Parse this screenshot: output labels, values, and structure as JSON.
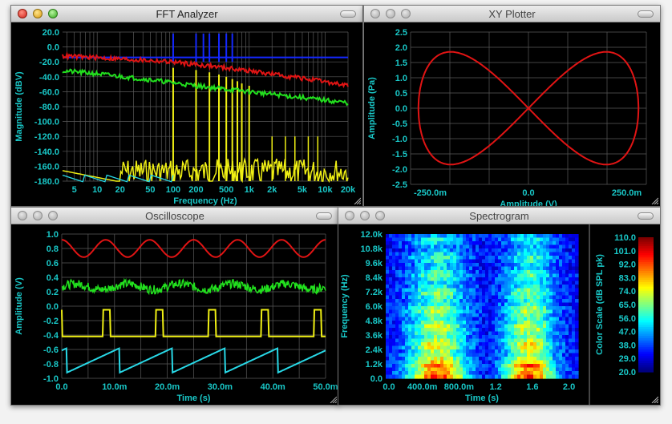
{
  "windows": {
    "fft": {
      "title": "FFT Analyzer",
      "y_ticks": [
        "20.0",
        "0.0",
        "-20.0",
        "-40.0",
        "-60.0",
        "-80.0",
        "-100.0",
        "-120.0",
        "-140.0",
        "-160.0",
        "-180.0"
      ],
      "x_ticks": [
        "5",
        "10",
        "20",
        "50",
        "100",
        "200",
        "500",
        "1k",
        "2k",
        "5k",
        "10k",
        "20k"
      ],
      "xlabel": "Frequency (Hz)",
      "ylabel": "Magnitude (dBV)"
    },
    "xy": {
      "title": "XY Plotter",
      "y_ticks": [
        "2.5",
        "2.0",
        "1.5",
        "1.0",
        "0.5",
        "0.0",
        "-0.5",
        "-1.0",
        "-1.5",
        "-2.0",
        "-2.5"
      ],
      "x_ticks": [
        "-250.0m",
        "0.0",
        "250.0m"
      ],
      "xlabel": "Amplitude (V)",
      "ylabel": "Amplitude (Pa)"
    },
    "osc": {
      "title": "Oscilloscope",
      "y_ticks": [
        "1.0",
        "0.8",
        "0.6",
        "0.4",
        "0.2",
        "0.0",
        "-0.2",
        "-0.4",
        "-0.6",
        "-0.8",
        "-1.0"
      ],
      "x_ticks": [
        "0.0",
        "10.0m",
        "20.0m",
        "30.0m",
        "40.0m",
        "50.0m"
      ],
      "xlabel": "Time (s)",
      "ylabel": "Amplitude (V)"
    },
    "spec": {
      "title": "Spectrogram",
      "y_ticks": [
        "12.0k",
        "10.8k",
        "9.6k",
        "8.4k",
        "7.2k",
        "6.0k",
        "4.8k",
        "3.6k",
        "2.4k",
        "1.2k",
        "0.0"
      ],
      "x_ticks": [
        "0.0",
        "400.0m",
        "800.0m",
        "1.2",
        "1.6",
        "2.0"
      ],
      "xlabel": "Time (s)",
      "ylabel": "Frequency (Hz)",
      "scale_label": "Color Scale (dB SPL pk)",
      "scale_ticks": [
        "110.0",
        "101.0",
        "92.0",
        "83.0",
        "74.0",
        "65.0",
        "56.0",
        "47.0",
        "38.0",
        "29.0",
        "20.0"
      ]
    }
  },
  "colors": {
    "axis_text": "#19c8c8",
    "red": "#e01414",
    "green": "#22e01e",
    "yellow": "#f0f014",
    "cyan": "#28d8e6",
    "blue": "#1428ff"
  },
  "chart_data": [
    {
      "type": "line",
      "id": "fft",
      "scale": "log-x",
      "xlim": [
        3.5,
        20000
      ],
      "ylim": [
        -180,
        20
      ],
      "series": [
        {
          "color": "blue",
          "points": [
            [
              3.5,
              -14
            ],
            [
              20000,
              -14
            ]
          ]
        },
        {
          "color": "red",
          "points": [
            [
              3.5,
              -12
            ],
            [
              20,
              -16
            ],
            [
              100,
              -20
            ],
            [
              500,
              -28
            ],
            [
              1000,
              -32
            ],
            [
              5000,
              -42
            ],
            [
              20000,
              -52
            ]
          ]
        },
        {
          "color": "green",
          "points": [
            [
              3.5,
              -32
            ],
            [
              10,
              -36
            ],
            [
              50,
              -44
            ],
            [
              200,
              -52
            ],
            [
              1000,
              -60
            ],
            [
              5000,
              -68
            ],
            [
              20000,
              -75
            ]
          ]
        }
      ]
    },
    {
      "type": "line",
      "id": "xy",
      "xlim": [
        -0.3,
        0.3
      ],
      "ylim": [
        -2.5,
        2.5
      ],
      "series": [
        {
          "color": "red",
          "shape": "lissajous",
          "x_amplitude": 0.28,
          "y_amplitude": 1.85
        }
      ]
    },
    {
      "type": "line",
      "id": "osc",
      "xlim": [
        0,
        0.05
      ],
      "ylim": [
        -1,
        1
      ],
      "series": [
        {
          "color": "red",
          "shape": "sine",
          "center": 0.8,
          "amplitude": 0.12,
          "cycles": 6
        },
        {
          "color": "green",
          "shape": "noise",
          "center": 0.27,
          "spread": 0.06
        },
        {
          "color": "yellow",
          "shape": "pulse",
          "low": -0.42,
          "high": -0.05,
          "cycles": 5
        },
        {
          "color": "cyan",
          "shape": "sawtooth",
          "low": -0.92,
          "high": -0.58,
          "cycles": 5
        }
      ]
    },
    {
      "type": "heatmap",
      "id": "spec",
      "xlim": [
        0,
        2.1
      ],
      "ylim": [
        0,
        12000
      ],
      "zlim": [
        20,
        110
      ]
    }
  ]
}
